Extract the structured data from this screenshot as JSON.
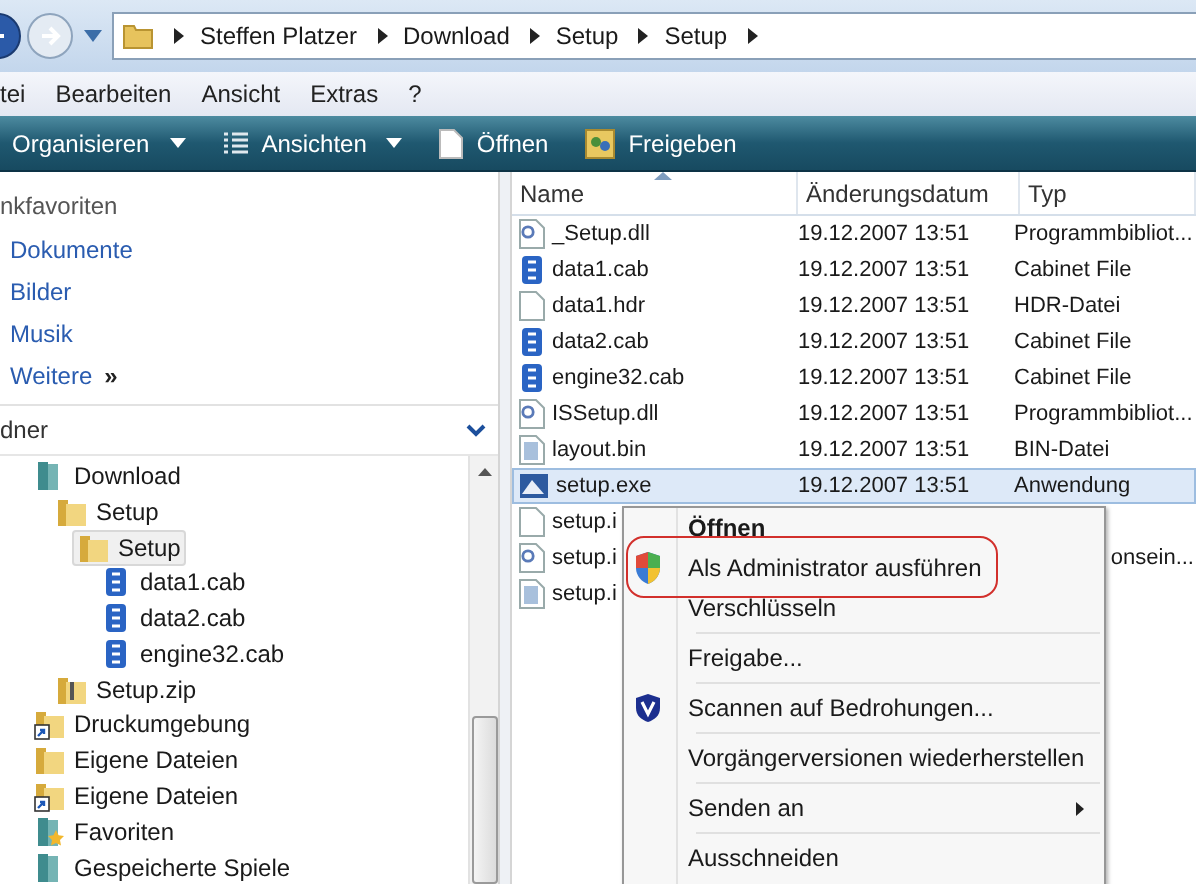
{
  "address_bar": {
    "breadcrumbs": [
      "Steffen Platzer",
      "Download",
      "Setup",
      "Setup"
    ]
  },
  "menu_bar": [
    "tei",
    "Bearbeiten",
    "Ansicht",
    "Extras",
    "?"
  ],
  "toolbar": [
    {
      "label": "Organisieren",
      "kind": "dropdown"
    },
    {
      "label": "Ansichten",
      "kind": "views"
    },
    {
      "label": "Öffnen",
      "kind": "open"
    },
    {
      "label": "Freigeben",
      "kind": "share"
    }
  ],
  "sidebar": {
    "favorites_header": "nkfavoriten",
    "favorites": [
      "Dokumente",
      "Bilder",
      "Musik",
      "Weitere"
    ],
    "more_mark": "»",
    "folders_header": "dner",
    "tree": [
      {
        "label": "Download",
        "kind": "special",
        "selected": false,
        "children": [
          {
            "label": "Setup",
            "kind": "folder",
            "selected": false,
            "children": [
              {
                "label": "Setup",
                "kind": "folder",
                "selected": true,
                "children": [
                  {
                    "label": "data1.cab",
                    "kind": "cab",
                    "selected": false
                  },
                  {
                    "label": "data2.cab",
                    "kind": "cab",
                    "selected": false
                  },
                  {
                    "label": "engine32.cab",
                    "kind": "cab",
                    "selected": false
                  }
                ]
              }
            ]
          },
          {
            "label": "Setup.zip",
            "kind": "zip",
            "selected": false
          }
        ]
      },
      {
        "label": "Druckumgebung",
        "kind": "shortcut",
        "selected": false
      },
      {
        "label": "Eigene Dateien",
        "kind": "folder",
        "selected": false
      },
      {
        "label": "Eigene Dateien",
        "kind": "shortcut",
        "selected": false
      },
      {
        "label": "Favoriten",
        "kind": "favorites",
        "selected": false
      },
      {
        "label": "Gespeicherte Spiele",
        "kind": "special",
        "selected": false
      }
    ]
  },
  "table": {
    "columns": [
      "Name",
      "Änderungsdatum",
      "Typ"
    ],
    "rows": [
      {
        "name": "_Setup.dll",
        "date": "19.12.2007 13:51",
        "type": "Programmbibliot...",
        "kind": "dll",
        "selected": false
      },
      {
        "name": "data1.cab",
        "date": "19.12.2007 13:51",
        "type": "Cabinet File",
        "kind": "cab",
        "selected": false
      },
      {
        "name": "data1.hdr",
        "date": "19.12.2007 13:51",
        "type": "HDR-Datei",
        "kind": "blank",
        "selected": false
      },
      {
        "name": "data2.cab",
        "date": "19.12.2007 13:51",
        "type": "Cabinet File",
        "kind": "cab",
        "selected": false
      },
      {
        "name": "engine32.cab",
        "date": "19.12.2007 13:51",
        "type": "Cabinet File",
        "kind": "cab",
        "selected": false
      },
      {
        "name": "ISSetup.dll",
        "date": "19.12.2007 13:51",
        "type": "Programmbibliot...",
        "kind": "dll",
        "selected": false
      },
      {
        "name": "layout.bin",
        "date": "19.12.2007 13:51",
        "type": "BIN-Datei",
        "kind": "bin",
        "selected": false
      },
      {
        "name": "setup.exe",
        "date": "19.12.2007 13:51",
        "type": "Anwendung",
        "kind": "exe",
        "selected": true
      },
      {
        "name": "setup.i",
        "kind": "blank",
        "selected": false
      },
      {
        "name": "setup.i",
        "type": "onsein...",
        "kind": "ini",
        "selected": false
      },
      {
        "name": "setup.i",
        "kind": "bin",
        "selected": false
      }
    ]
  },
  "context_menu": {
    "items": [
      {
        "label": "Öffnen",
        "kind": "plain",
        "default": true,
        "outlined": false,
        "submenu": false
      },
      {
        "label": "Als Administrator ausführen",
        "kind": "shield",
        "default": false,
        "outlined": true,
        "submenu": false
      },
      {
        "label": "Verschlüsseln",
        "kind": "plain",
        "default": false,
        "outlined": false,
        "submenu": false
      },
      {
        "kind": "separator"
      },
      {
        "label": "Freigabe...",
        "kind": "plain",
        "default": false,
        "outlined": false,
        "submenu": false
      },
      {
        "kind": "separator"
      },
      {
        "label": "Scannen auf Bedrohungen...",
        "kind": "scan",
        "default": false,
        "outlined": false,
        "submenu": false
      },
      {
        "kind": "separator"
      },
      {
        "label": "Vorgängerversionen wiederherstellen",
        "kind": "plain",
        "default": false,
        "outlined": false,
        "submenu": false
      },
      {
        "kind": "separator"
      },
      {
        "label": "Senden an",
        "kind": "plain",
        "default": false,
        "outlined": false,
        "submenu": true
      },
      {
        "kind": "separator"
      },
      {
        "label": "Ausschneiden",
        "kind": "plain",
        "default": false,
        "outlined": false,
        "submenu": false
      }
    ]
  }
}
